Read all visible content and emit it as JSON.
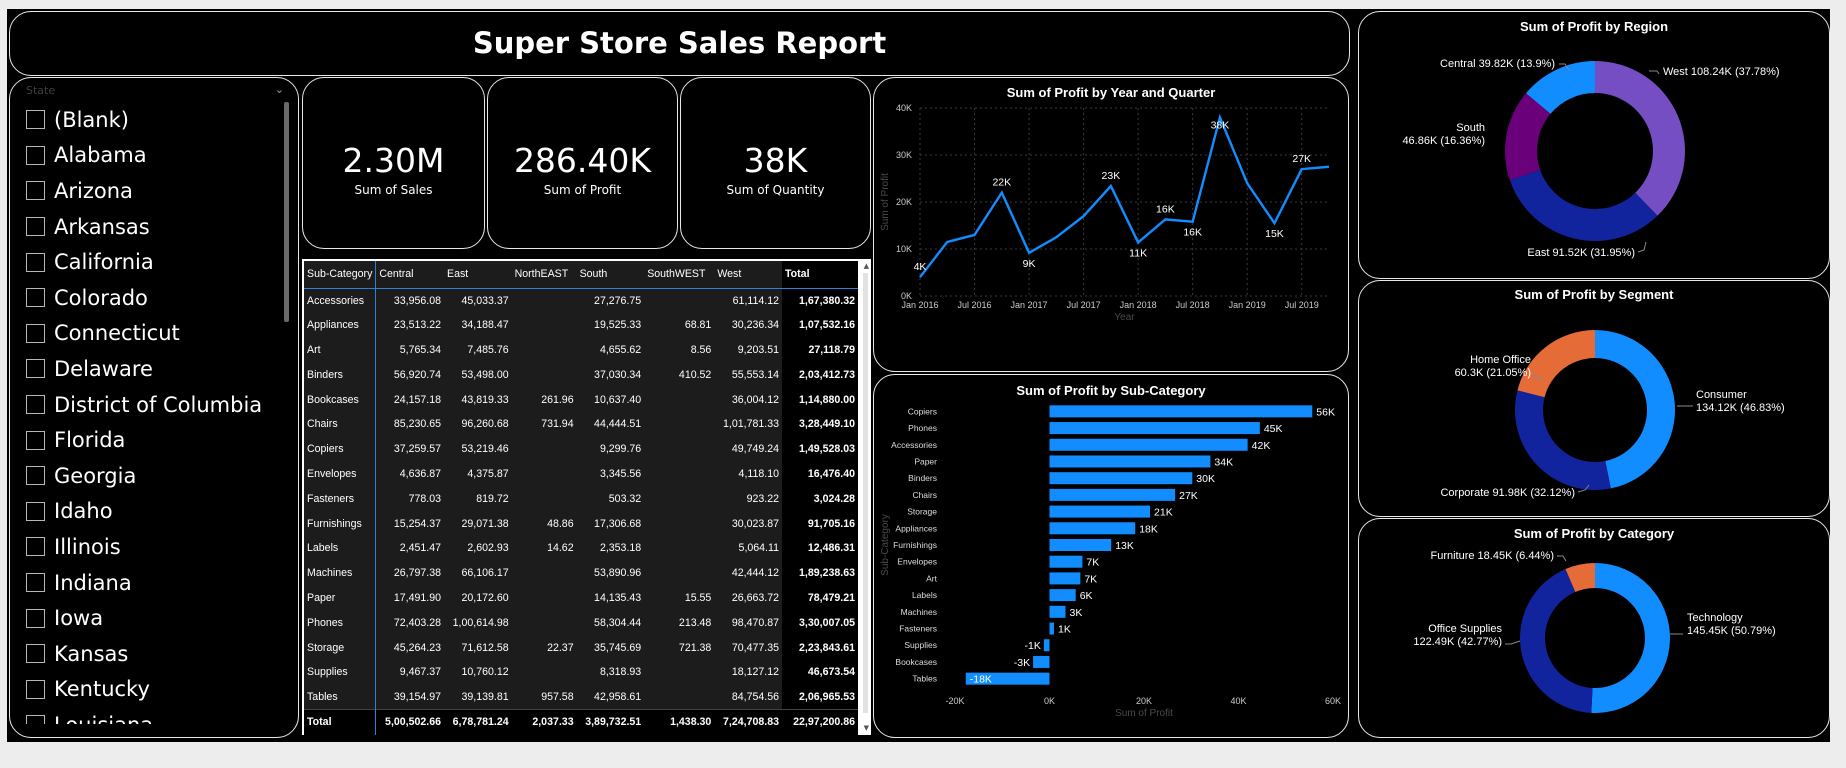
{
  "report": {
    "title": "Super Store Sales Report"
  },
  "slicer": {
    "header": "State",
    "items": [
      "(Blank)",
      "Alabama",
      "Arizona",
      "Arkansas",
      "California",
      "Colorado",
      "Connecticut",
      "Delaware",
      "District of Columbia",
      "Florida",
      "Georgia",
      "Idaho",
      "Illinois",
      "Indiana",
      "Iowa",
      "Kansas",
      "Kentucky",
      "Louisiana"
    ]
  },
  "kpis": [
    {
      "value": "2.30M",
      "label": "Sum of Sales"
    },
    {
      "value": "286.40K",
      "label": "Sum of Profit"
    },
    {
      "value": "38K",
      "label": "Sum of Quantity"
    }
  ],
  "table": {
    "columns": [
      "Sub-Category",
      "Central",
      "East",
      "NorthEAST",
      "South",
      "SouthWEST",
      "West",
      "Total"
    ],
    "rows": [
      [
        "Accessories",
        "33,956.08",
        "45,033.37",
        "",
        "27,276.75",
        "",
        "61,114.12",
        "1,67,380.32"
      ],
      [
        "Appliances",
        "23,513.22",
        "34,188.47",
        "",
        "19,525.33",
        "68.81",
        "30,236.34",
        "1,07,532.16"
      ],
      [
        "Art",
        "5,765.34",
        "7,485.76",
        "",
        "4,655.62",
        "8.56",
        "9,203.51",
        "27,118.79"
      ],
      [
        "Binders",
        "56,920.74",
        "53,498.00",
        "",
        "37,030.34",
        "410.52",
        "55,553.14",
        "2,03,412.73"
      ],
      [
        "Bookcases",
        "24,157.18",
        "43,819.33",
        "261.96",
        "10,637.40",
        "",
        "36,004.12",
        "1,14,880.00"
      ],
      [
        "Chairs",
        "85,230.65",
        "96,260.68",
        "731.94",
        "44,444.51",
        "",
        "1,01,781.33",
        "3,28,449.10"
      ],
      [
        "Copiers",
        "37,259.57",
        "53,219.46",
        "",
        "9,299.76",
        "",
        "49,749.24",
        "1,49,528.03"
      ],
      [
        "Envelopes",
        "4,636.87",
        "4,375.87",
        "",
        "3,345.56",
        "",
        "4,118.10",
        "16,476.40"
      ],
      [
        "Fasteners",
        "778.03",
        "819.72",
        "",
        "503.32",
        "",
        "923.22",
        "3,024.28"
      ],
      [
        "Furnishings",
        "15,254.37",
        "29,071.38",
        "48.86",
        "17,306.68",
        "",
        "30,023.87",
        "91,705.16"
      ],
      [
        "Labels",
        "2,451.47",
        "2,602.93",
        "14.62",
        "2,353.18",
        "",
        "5,064.11",
        "12,486.31"
      ],
      [
        "Machines",
        "26,797.38",
        "66,106.17",
        "",
        "53,890.96",
        "",
        "42,444.12",
        "1,89,238.63"
      ],
      [
        "Paper",
        "17,491.90",
        "20,172.60",
        "",
        "14,135.43",
        "15.55",
        "26,663.72",
        "78,479.21"
      ],
      [
        "Phones",
        "72,403.28",
        "1,00,614.98",
        "",
        "58,304.44",
        "213.48",
        "98,470.87",
        "3,30,007.05"
      ],
      [
        "Storage",
        "45,264.23",
        "71,612.58",
        "22.37",
        "35,745.69",
        "721.38",
        "70,477.35",
        "2,23,843.61"
      ],
      [
        "Supplies",
        "9,467.37",
        "10,760.12",
        "",
        "8,318.93",
        "",
        "18,127.12",
        "46,673.54"
      ],
      [
        "Tables",
        "39,154.97",
        "39,139.81",
        "957.58",
        "42,958.61",
        "",
        "84,754.56",
        "2,06,965.53"
      ]
    ],
    "total": [
      "Total",
      "5,00,502.66",
      "6,78,781.24",
      "2,037.33",
      "3,89,732.51",
      "1,438.30",
      "7,24,708.83",
      "22,97,200.86"
    ]
  },
  "colors": {
    "accent": "#118dff",
    "dark_blue": "#12239e",
    "purple": "#744ec2",
    "violet": "#6b007b",
    "orange": "#e66c37",
    "background": "#000000"
  },
  "icons": {
    "slicer_dropdown": "chevron-down-icon",
    "scroll_up": "triangle-up-icon",
    "scroll_down": "triangle-down-icon"
  },
  "chart_data": [
    {
      "type": "line",
      "title": "Sum of Profit by Year and Quarter",
      "xlabel": "Year",
      "ylabel": "Sum of Profit",
      "x": [
        "2016 Q1",
        "2016 Q2",
        "2016 Q3",
        "2016 Q4",
        "2017 Q1",
        "2017 Q2",
        "2017 Q3",
        "2017 Q4",
        "2018 Q1",
        "2018 Q2",
        "2018 Q3",
        "2018 Q4",
        "2019 Q1",
        "2019 Q2",
        "2019 Q3",
        "2019 Q4"
      ],
      "values": [
        4000,
        11500,
        13000,
        22000,
        9200,
        12500,
        17000,
        23400,
        11400,
        16300,
        15800,
        38000,
        24000,
        15500,
        27000,
        27500
      ],
      "data_labels": [
        {
          "x": "2016 Q1",
          "text": "4K"
        },
        {
          "x": "2016 Q4",
          "text": "22K"
        },
        {
          "x": "2017 Q1",
          "text": "9K"
        },
        {
          "x": "2017 Q4",
          "text": "23K"
        },
        {
          "x": "2018 Q1",
          "text": "11K"
        },
        {
          "x": "2018 Q2",
          "text": "16K"
        },
        {
          "x": "2018 Q3",
          "text": "16K"
        },
        {
          "x": "2018 Q4",
          "text": "38K"
        },
        {
          "x": "2019 Q2",
          "text": "15K"
        },
        {
          "x": "2019 Q3",
          "text": "27K"
        }
      ],
      "xticks": [
        {
          "x": "2016 Q1",
          "label": "Jan 2016"
        },
        {
          "x": "2016 Q3",
          "label": "Jul 2016"
        },
        {
          "x": "2017 Q1",
          "label": "Jan 2017"
        },
        {
          "x": "2017 Q3",
          "label": "Jul 2017"
        },
        {
          "x": "2018 Q1",
          "label": "Jan 2018"
        },
        {
          "x": "2018 Q3",
          "label": "Jul 2018"
        },
        {
          "x": "2019 Q1",
          "label": "Jan 2019"
        },
        {
          "x": "2019 Q3",
          "label": "Jul 2019"
        }
      ],
      "yticks": [
        "0K",
        "10K",
        "20K",
        "30K",
        "40K"
      ],
      "ylim": [
        0,
        40000
      ],
      "grid": true
    },
    {
      "type": "bar",
      "orientation": "horizontal",
      "title": "Sum of Profit by Sub-Category",
      "xlabel": "Sum of Profit",
      "ylabel": "Sub-Category",
      "categories": [
        "Copiers",
        "Phones",
        "Accessories",
        "Paper",
        "Binders",
        "Chairs",
        "Storage",
        "Appliances",
        "Furnishings",
        "Envelopes",
        "Art",
        "Labels",
        "Machines",
        "Fasteners",
        "Supplies",
        "Bookcases",
        "Tables"
      ],
      "values": [
        55618,
        44516,
        41937,
        34054,
        30222,
        26590,
        21279,
        18138,
        13059,
        6964,
        6528,
        5546,
        3385,
        950,
        -1189,
        -3473,
        -17725
      ],
      "data_labels": [
        "56K",
        "45K",
        "42K",
        "34K",
        "30K",
        "27K",
        "21K",
        "18K",
        "13K",
        "7K",
        "7K",
        "6K",
        "3K",
        "1K",
        "-1K",
        "-3K",
        "-18K"
      ],
      "xticks": [
        "-20K",
        "0K",
        "20K",
        "40K",
        "60K"
      ],
      "xlim": [
        -20000,
        60000
      ]
    },
    {
      "type": "pie",
      "donut": true,
      "title": "Sum of Profit by Region",
      "slices": [
        {
          "name": "West",
          "value": 37.78,
          "label": "West 108.24K (37.78%)",
          "color": "#744ec2"
        },
        {
          "name": "East",
          "value": 31.95,
          "label": "East 91.52K (31.95%)",
          "color": "#12239e"
        },
        {
          "name": "South",
          "value": 16.36,
          "label": "South 46.86K (16.36%)",
          "color": "#6b007b"
        },
        {
          "name": "Central",
          "value": 13.9,
          "label": "Central 39.82K (13.9%)",
          "color": "#118dff"
        }
      ]
    },
    {
      "type": "pie",
      "donut": true,
      "title": "Sum of Profit by Segment",
      "slices": [
        {
          "name": "Consumer",
          "value": 46.83,
          "label": "Consumer 134.12K (46.83%)",
          "color": "#118dff"
        },
        {
          "name": "Corporate",
          "value": 32.12,
          "label": "Corporate 91.98K (32.12%)",
          "color": "#12239e"
        },
        {
          "name": "Home Office",
          "value": 21.05,
          "label": "Home Office 60.3K (21.05%)",
          "color": "#e66c37"
        }
      ]
    },
    {
      "type": "pie",
      "donut": true,
      "title": "Sum of Profit by Category",
      "slices": [
        {
          "name": "Technology",
          "value": 50.79,
          "label": "Technology 145.45K (50.79%)",
          "color": "#118dff"
        },
        {
          "name": "Office Supplies",
          "value": 42.77,
          "label": "Office Supplies 122.49K (42.77%)",
          "color": "#12239e"
        },
        {
          "name": "Furniture",
          "value": 6.44,
          "label": "Furniture 18.45K (6.44%)",
          "color": "#e66c37"
        }
      ]
    }
  ]
}
